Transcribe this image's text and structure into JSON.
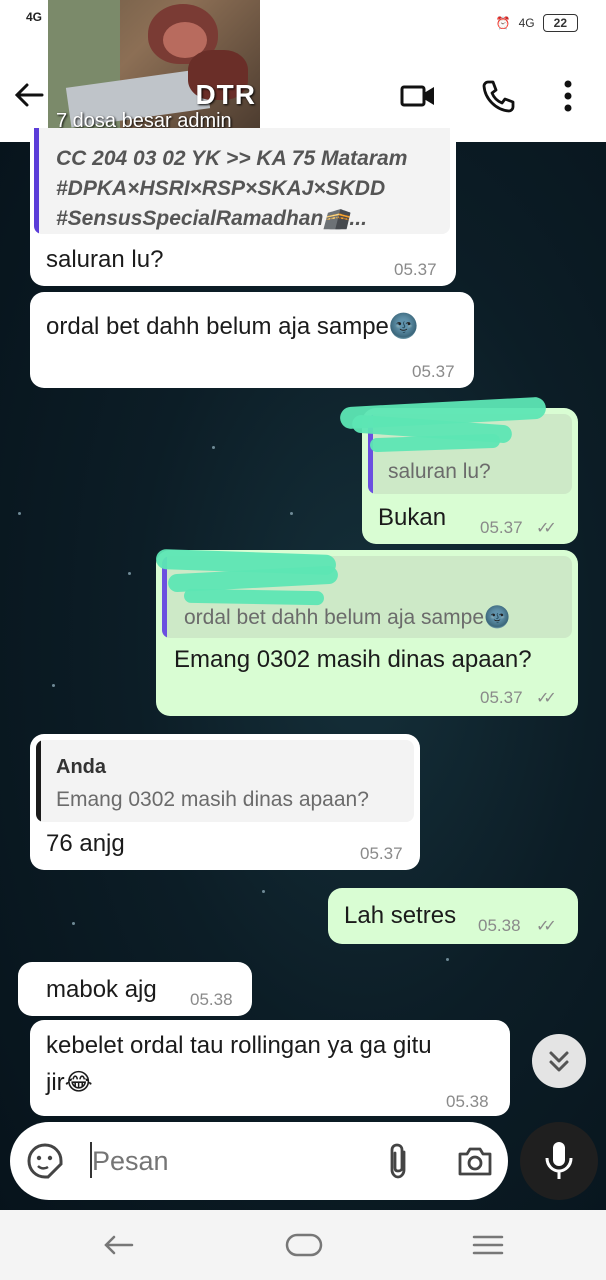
{
  "status_bar": {
    "network_left": "4G",
    "network_right": "4G",
    "battery": "22"
  },
  "chat_header": {
    "thumbnail_title": "DTR",
    "thumbnail_subtitle": "7 dosa besar admin"
  },
  "messages": [
    {
      "id": "m1",
      "direction": "in",
      "forwarded_lines": [
        "CC 204 03 02 YK >> KA 75 Mataram",
        "#DPKA×HSRI×RSP×SKAJ×SKDD",
        "#SensusSpecialRamadhan🕋..."
      ],
      "text": "saluran lu?",
      "time": "05.37"
    },
    {
      "id": "m2",
      "direction": "in",
      "text": "ordal bet dahh belum aja sampe🌚",
      "time": "05.37"
    },
    {
      "id": "m3",
      "direction": "out",
      "quote_text": "saluran lu?",
      "text": "Bukan",
      "time": "05.37"
    },
    {
      "id": "m4",
      "direction": "out",
      "quote_text": "ordal bet dahh belum aja sampe🌚",
      "text": "Emang 0302 masih dinas apaan?",
      "time": "05.37"
    },
    {
      "id": "m5",
      "direction": "in",
      "quote_author": "Anda",
      "quote_text": "Emang 0302 masih dinas apaan?",
      "text": "76 anjg",
      "time": "05.37"
    },
    {
      "id": "m6",
      "direction": "out",
      "text": "Lah setres",
      "time": "05.38"
    },
    {
      "id": "m7",
      "direction": "in",
      "text": "mabok ajg",
      "time": "05.38"
    },
    {
      "id": "m8",
      "direction": "in",
      "text_lines": [
        "kebelet ordal tau rollingan ya ga gitu",
        "jir😂"
      ],
      "time": "05.38"
    }
  ],
  "composer": {
    "placeholder": "Pesan"
  },
  "icons": {
    "back": "arrow-left-icon",
    "video": "video-call-icon",
    "call": "phone-icon",
    "menu": "more-vert-icon",
    "emoji": "sticker-icon",
    "attach": "paperclip-icon",
    "camera": "camera-icon",
    "mic": "mic-icon",
    "scroll": "chevrons-down-icon"
  },
  "colors": {
    "incoming": "#ffffff",
    "outgoing": "#d9fdd3",
    "quote_bar_in": "#5b3dd8",
    "quote_bar_out": "#6b4fe0",
    "scribble": "#5de6b4"
  }
}
